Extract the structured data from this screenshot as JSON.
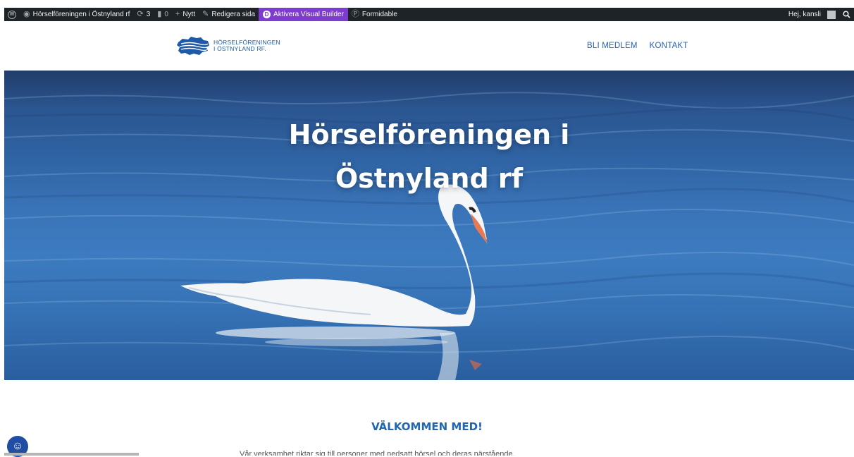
{
  "admin_bar": {
    "site_name": "Hörselföreningen i Östnyland rf",
    "updates_count": "3",
    "comments_count": "0",
    "new_label": "Nytt",
    "edit_label": "Redigera sida",
    "visual_builder_label": "Aktivera Visual Builder",
    "formidable_label": "Formidable",
    "greeting": "Hej, kansli"
  },
  "header": {
    "logo_line1": "HÖRSELFÖRENINGEN",
    "logo_line2": "I ÖSTNYLAND RF.",
    "nav": [
      "BLI MEDLEM",
      "KONTAKT"
    ]
  },
  "hero": {
    "title_line1": "Hörselföreningen i",
    "title_line2": "Östnyland rf"
  },
  "content": {
    "welcome_heading": "VÄLKOMMEN MED!",
    "intro_text": "Vår verksamhet riktar sig till personer med nedsatt hörsel och deras närstående."
  },
  "colors": {
    "admin_bar": "#1d2327",
    "visual_builder": "#7e3bd0",
    "brand_blue": "#2067b2"
  }
}
